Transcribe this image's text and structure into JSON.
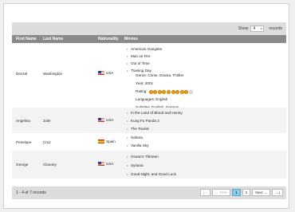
{
  "toolbar": {
    "show_label": "Show",
    "page_size": "4",
    "records_label": "records"
  },
  "columns": {
    "first_name": "First Name",
    "last_name": "Last Name",
    "nationality": "Nationality",
    "movies": "Movies"
  },
  "rows": [
    {
      "first": "Denzel",
      "last": "Washington",
      "nationality": "USA",
      "flag": "us-flag-icon",
      "movies": [
        "American Gangster",
        "Man on Fire",
        "Out of Time",
        "Training Day"
      ],
      "details": {
        "genre": "Genre: Crime, Drama, Thriller",
        "year": "Year: 2001",
        "rating_label": "Rating:",
        "rating": 8.5,
        "rating_max": 10,
        "languages": "Languages: English",
        "subtitles": "Subtitles: English, German"
      }
    },
    {
      "first": "Angelina",
      "last": "Jolie",
      "nationality": "USA",
      "flag": "us-flag-icon",
      "movies": [
        "In the Land of Blood and Honey",
        "Kung Fu Panda 2",
        "The Tourist"
      ]
    },
    {
      "first": "Penelope",
      "last": "Cruz",
      "nationality": "Spain",
      "flag": "spain-flag-icon",
      "movies": [
        "Sahara",
        "Vanilla Sky"
      ]
    },
    {
      "first": "George",
      "last": "Clooney",
      "nationality": "USA",
      "flag": "us-flag-icon",
      "movies": [
        "Ocean's Thirteen",
        "Syriana",
        "Good Night, and Good Luck"
      ]
    }
  ],
  "footer": {
    "info": "1 - 4 of 7 records",
    "first": "|←",
    "prev": "← Prev",
    "page1": "1",
    "page2": "2",
    "next": "Next →",
    "last": "→|"
  }
}
